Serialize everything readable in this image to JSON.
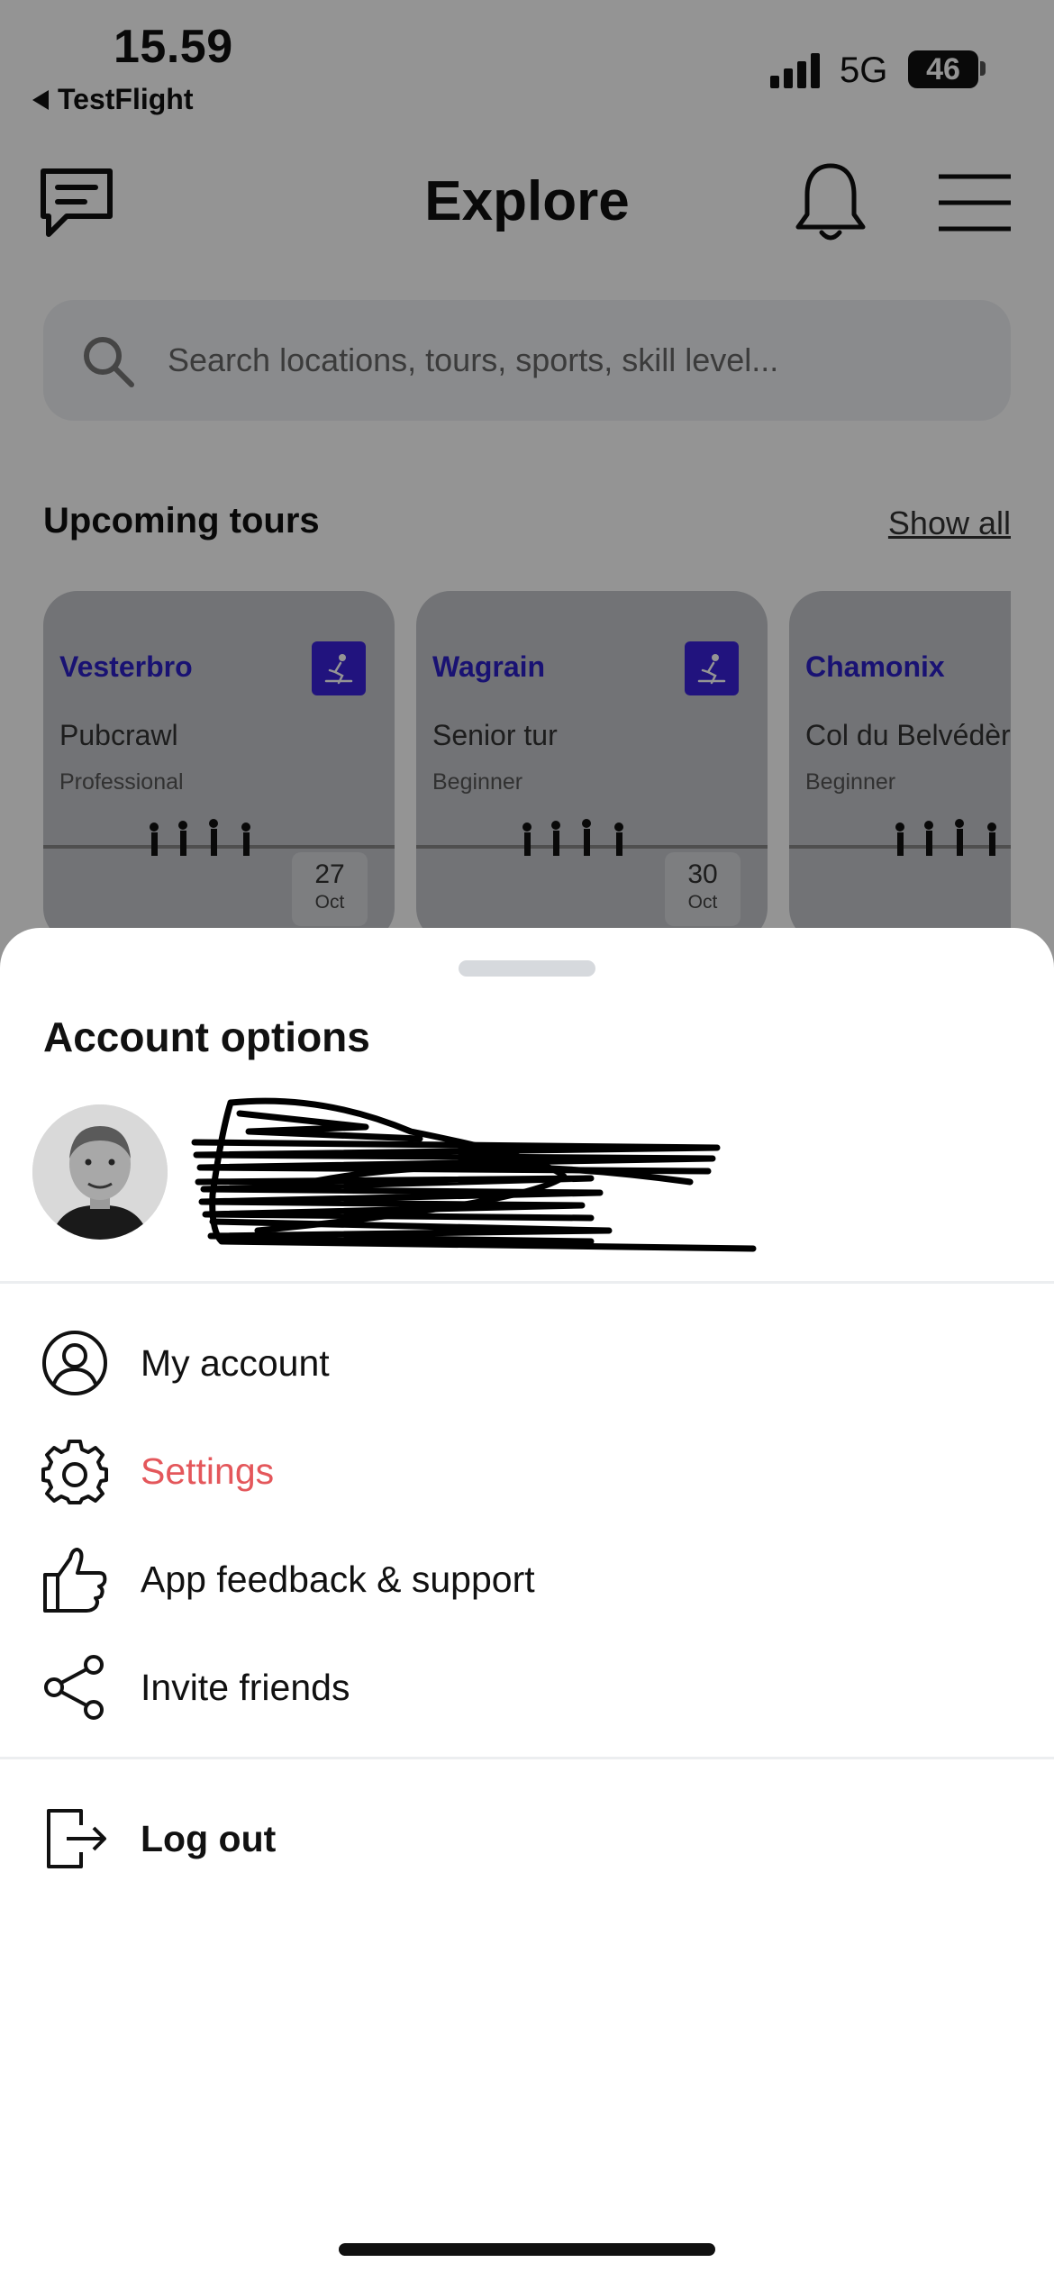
{
  "status_bar": {
    "time": "15.59",
    "back_app": "TestFlight",
    "network": "5G",
    "battery": "46"
  },
  "header": {
    "title": "Explore"
  },
  "search": {
    "placeholder": "Search locations, tours, sports, skill level..."
  },
  "upcoming": {
    "title": "Upcoming tours",
    "show_all": "Show all",
    "tours": [
      {
        "location": "Vesterbro",
        "name": "Pubcrawl",
        "level": "Professional",
        "day": "27",
        "month": "Oct"
      },
      {
        "location": "Wagrain",
        "name": "Senior tur",
        "level": "Beginner",
        "day": "30",
        "month": "Oct"
      },
      {
        "location": "Chamonix",
        "name": "Col du Belvédère",
        "level": "Beginner"
      }
    ]
  },
  "account_sheet": {
    "title": "Account options",
    "menu": [
      {
        "label": "My account",
        "icon": "user-circle-icon"
      },
      {
        "label": "Settings",
        "icon": "gear-icon"
      },
      {
        "label": "App feedback & support",
        "icon": "thumbs-up-icon"
      },
      {
        "label": "Invite friends",
        "icon": "share-icon"
      }
    ],
    "logout": {
      "label": "Log out",
      "icon": "log-out-icon"
    }
  },
  "colors": {
    "accent": "#e4575b",
    "brand": "#3a21d9",
    "dim_overlay": "rgba(0,0,0,0.42)"
  }
}
